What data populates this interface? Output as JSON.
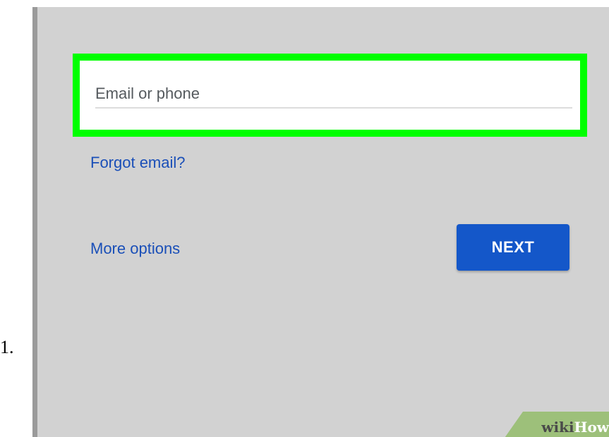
{
  "step": {
    "number": "1."
  },
  "signin": {
    "email_placeholder": "Email or phone",
    "email_value": "",
    "forgot_email_label": "Forgot email?",
    "more_options_label": "More options",
    "next_label": "NEXT"
  },
  "watermark": {
    "wiki": "wiki",
    "how": "How"
  },
  "colors": {
    "background": "#d2d2d2",
    "highlight": "#00ff00",
    "link": "#1a4fb8",
    "button": "#1457c9",
    "watermark_bg": "#9dc07a"
  }
}
